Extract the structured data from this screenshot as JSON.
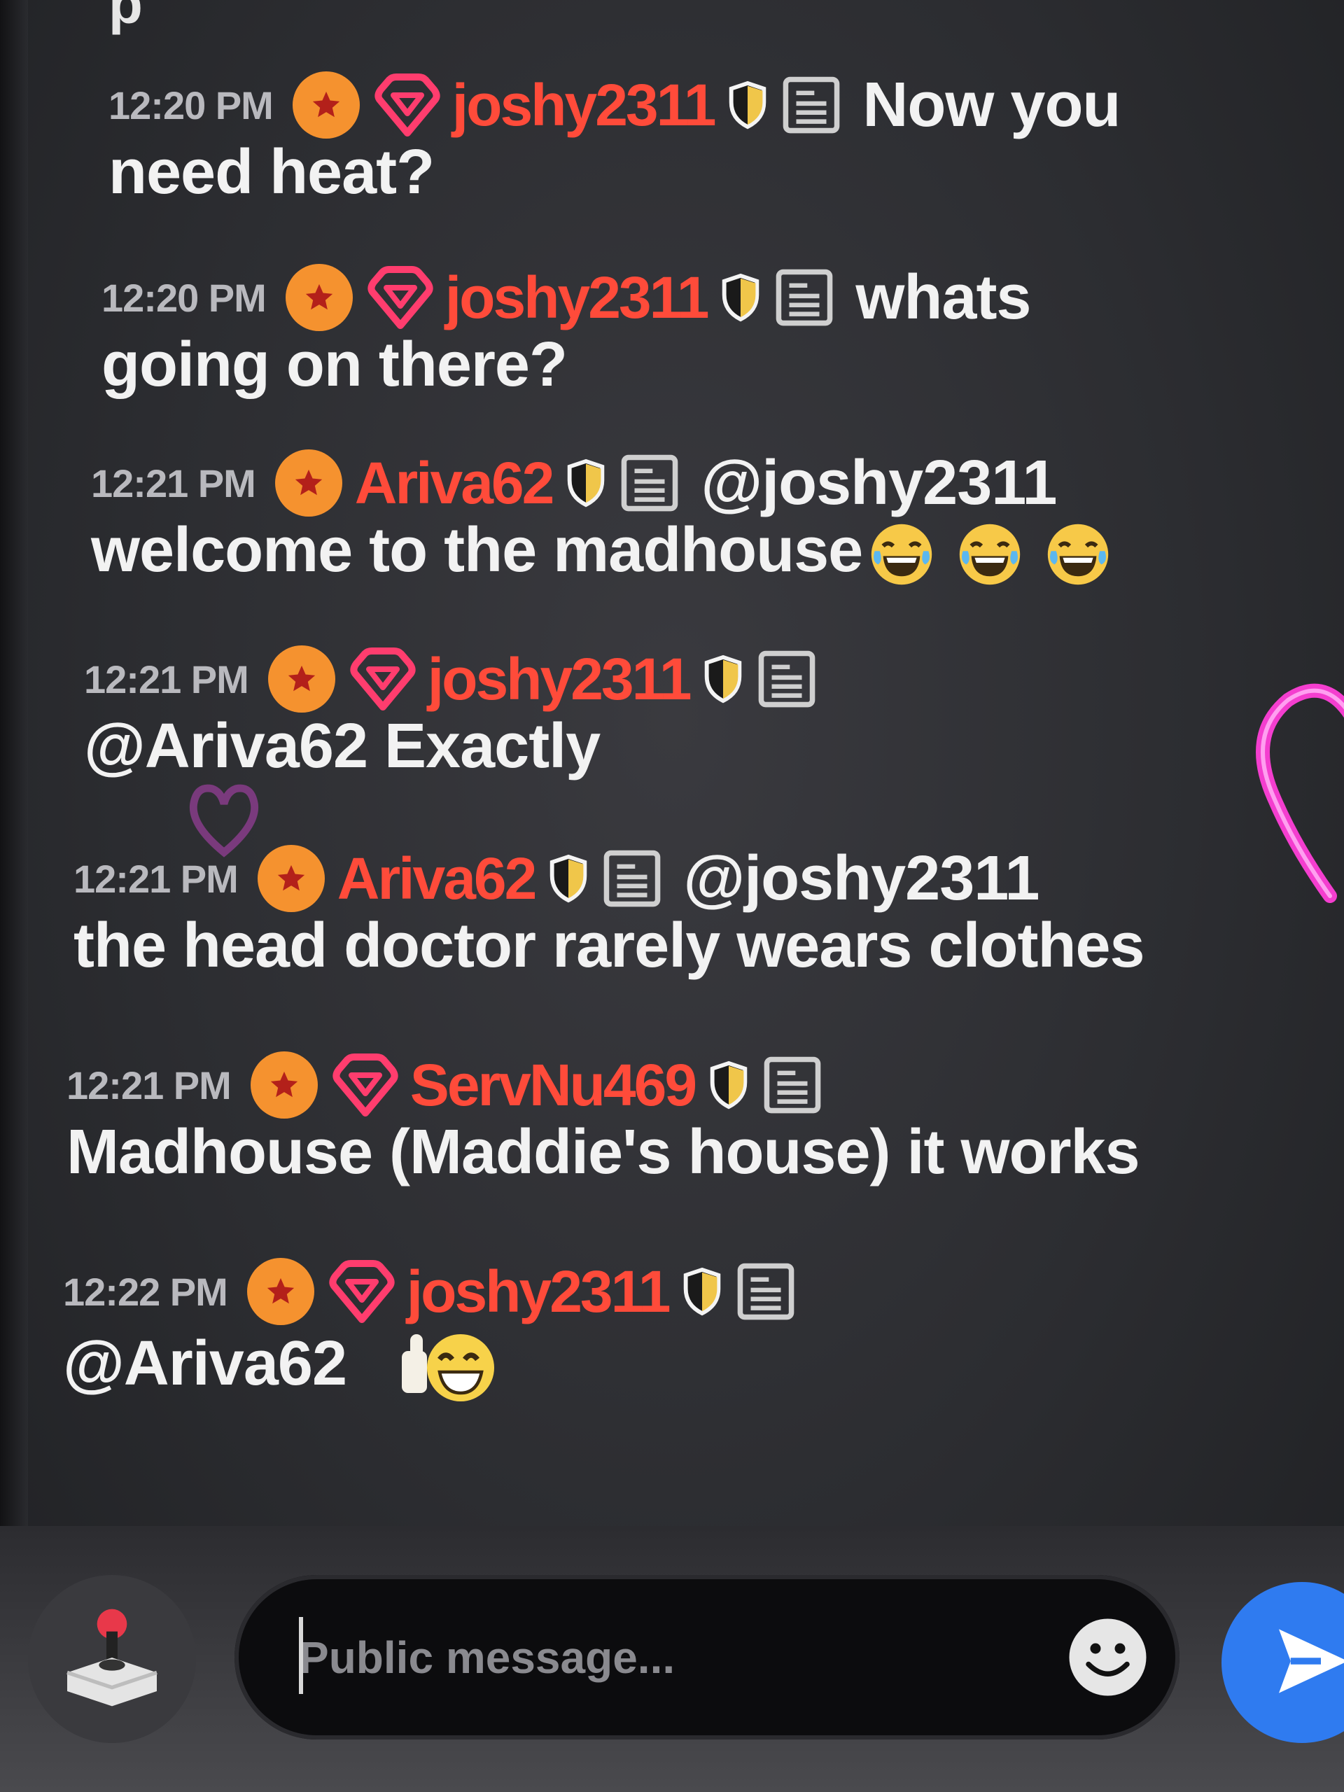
{
  "top_fragment": "p",
  "messages": [
    {
      "time": "12:20 PM",
      "badges": [
        "star-badge-icon",
        "gem-badge-icon"
      ],
      "username": "joshy2311",
      "inline_text": "Now you",
      "continuation": "need heat?"
    },
    {
      "time": "12:20 PM",
      "badges": [
        "star-badge-icon",
        "gem-badge-icon"
      ],
      "username": "joshy2311",
      "inline_text": "whats",
      "continuation": "going on there?"
    },
    {
      "time": "12:21 PM",
      "badges": [
        "star-badge-icon"
      ],
      "username": "Ariva62",
      "inline_text": "@joshy2311",
      "continuation": "welcome to the madhouse",
      "emojis": [
        "tears-of-joy-icon",
        "tears-of-joy-icon",
        "tears-of-joy-icon"
      ]
    },
    {
      "time": "12:21 PM",
      "badges": [
        "star-badge-icon",
        "gem-badge-icon"
      ],
      "username": "joshy2311",
      "inline_text": "",
      "continuation": "@Ariva62  Exactly"
    },
    {
      "time": "12:21 PM",
      "badges": [
        "star-badge-icon"
      ],
      "username": "Ariva62",
      "inline_text": "@joshy2311",
      "continuation": "the head doctor rarely wears clothes"
    },
    {
      "time": "12:21 PM",
      "badges": [
        "star-badge-icon",
        "gem-badge-icon"
      ],
      "username": "ServNu469",
      "inline_text": "",
      "continuation": "Madhouse (Maddie's house) it works"
    },
    {
      "time": "12:22 PM",
      "badges": [
        "star-badge-icon",
        "gem-badge-icon"
      ],
      "username": "joshy2311",
      "inline_text": "",
      "continuation": "@Ariva62",
      "emojis": [
        "thumbs-up-grin-icon"
      ]
    }
  ],
  "composer": {
    "placeholder": "Public message...",
    "game_icon": "joystick-icon",
    "emoji_icon": "smiley-icon",
    "send_icon": "send-arrow-icon"
  },
  "colors": {
    "username": "#ff4b3a",
    "star_badge": "#f5922f",
    "gem_badge": "#ff3d6e",
    "send_button": "#2f7bf0",
    "neon_heart": "#ff3fd8"
  }
}
